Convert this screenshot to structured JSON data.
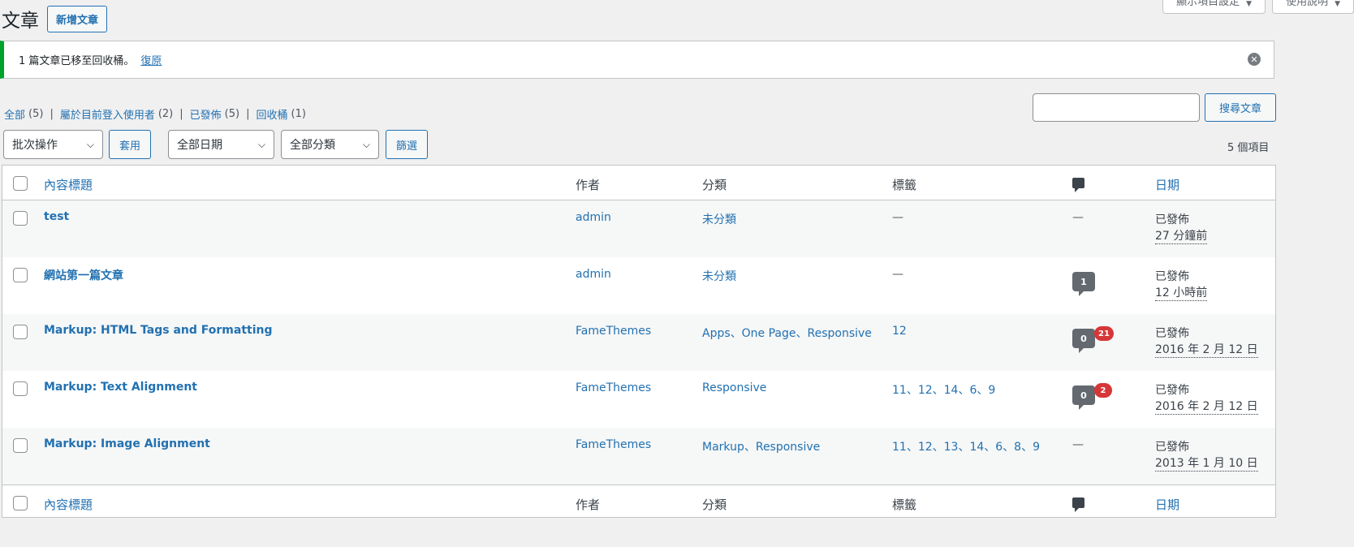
{
  "screen_tabs": [
    {
      "label": "顯示項目設定"
    },
    {
      "label": "使用說明"
    }
  ],
  "page_title": "文章",
  "add_new_label": "新增文章",
  "notice": {
    "message": "1 篇文章已移至回收桶。",
    "undo_label": "復原"
  },
  "views": [
    {
      "label": "全部",
      "count": "(5)"
    },
    {
      "label": "屬於目前登入使用者",
      "count": "(2)"
    },
    {
      "label": "已發佈",
      "count": "(5)"
    },
    {
      "label": "回收桶",
      "count": "(1)"
    }
  ],
  "search": {
    "button_label": "搜尋文章",
    "value": ""
  },
  "filters": {
    "bulk_action": "批次操作",
    "apply_label": "套用",
    "date": "全部日期",
    "category": "全部分類",
    "filter_label": "篩選"
  },
  "items_count": "5 個項目",
  "columns": {
    "title": "內容標題",
    "author": "作者",
    "categories": "分類",
    "tags": "標籤",
    "date": "日期"
  },
  "posts": [
    {
      "title": "test",
      "author": "admin",
      "categories": "未分類",
      "tags": "—",
      "comments": null,
      "pending": null,
      "comments_text": "—",
      "status": "已發佈",
      "date": "27 分鐘前"
    },
    {
      "title": "網站第一篇文章",
      "author": "admin",
      "categories": "未分類",
      "tags": "—",
      "comments": "1",
      "pending": null,
      "comments_text": "",
      "status": "已發佈",
      "date": "12 小時前"
    },
    {
      "title": "Markup: HTML Tags and Formatting",
      "author": "FameThemes",
      "categories": "Apps、One Page、Responsive",
      "tags": "12",
      "comments": "0",
      "pending": "21",
      "comments_text": "",
      "status": "已發佈",
      "date": "2016 年 2 月 12 日"
    },
    {
      "title": "Markup: Text Alignment",
      "author": "FameThemes",
      "categories": "Responsive",
      "tags": "11、12、14、6、9",
      "comments": "0",
      "pending": "2",
      "comments_text": "",
      "status": "已發佈",
      "date": "2016 年 2 月 12 日"
    },
    {
      "title": "Markup: Image Alignment",
      "author": "FameThemes",
      "categories": "Markup、Responsive",
      "tags": "11、12、13、14、6、8、9",
      "comments": null,
      "pending": null,
      "comments_text": "—",
      "status": "已發佈",
      "date": "2013 年 1 月 10 日"
    }
  ],
  "colors": {
    "accent": "#2271b1",
    "success": "#00a32a",
    "pending": "#d63638"
  }
}
